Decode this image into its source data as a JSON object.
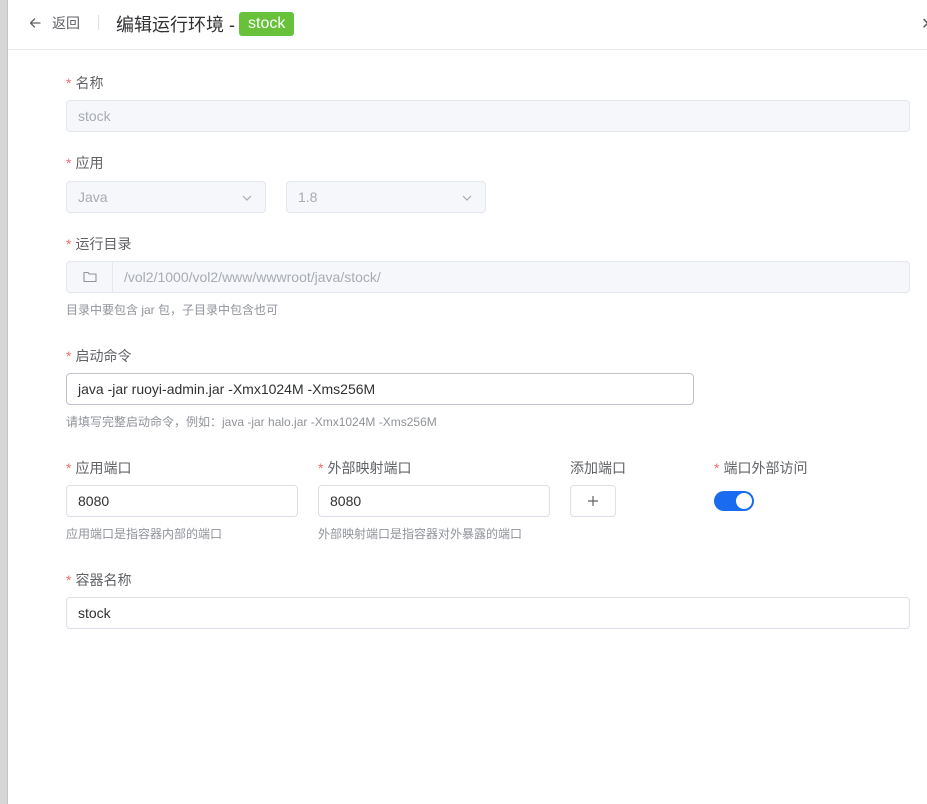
{
  "header": {
    "back_label": "返回",
    "title": "编辑运行环境 -",
    "tag": "stock"
  },
  "form": {
    "name": {
      "label": "名称",
      "value": "stock"
    },
    "app": {
      "label": "应用",
      "language": "Java",
      "version": "1.8"
    },
    "run_dir": {
      "label": "运行目录",
      "value": "/vol2/1000/vol2/www/wwwroot/java/stock/",
      "hint": "目录中要包含 jar 包，子目录中包含也可"
    },
    "start_cmd": {
      "label": "启动命令",
      "value": "java -jar ruoyi-admin.jar -Xmx1024M -Xms256M",
      "hint": "请填写完整启动命令，例如：java -jar halo.jar -Xmx1024M -Xms256M"
    },
    "app_port": {
      "label": "应用端口",
      "value": "8080",
      "hint": "应用端口是指容器内部的端口"
    },
    "ext_port": {
      "label": "外部映射端口",
      "value": "8080",
      "hint": "外部映射端口是指容器对外暴露的端口"
    },
    "add_port": {
      "label": "添加端口"
    },
    "external_access": {
      "label": "端口外部访问",
      "enabled": true
    },
    "container_name": {
      "label": "容器名称",
      "value": "stock"
    }
  },
  "icons": {
    "back": "arrow-left-icon",
    "folder": "folder-icon",
    "select": "chevron-down-icon",
    "add": "plus-icon"
  },
  "colors": {
    "accent": "#1a6bf0",
    "tag": "#67c23a",
    "required": "#f56c6c"
  }
}
